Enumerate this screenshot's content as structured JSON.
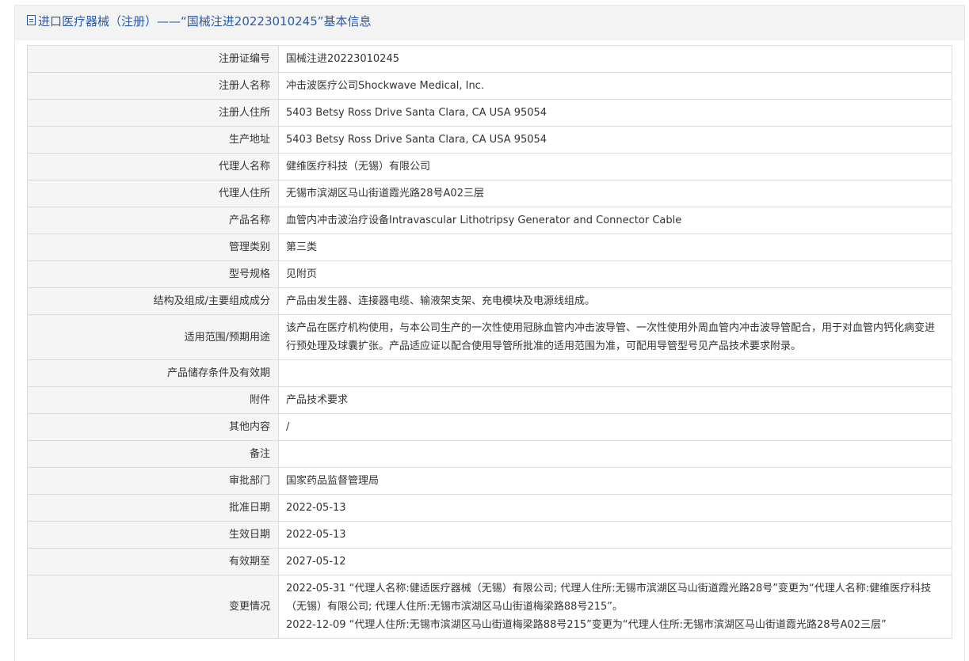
{
  "header": {
    "title": "进口医疗器械（注册）——“国械注进20223010245”基本信息"
  },
  "rows": [
    {
      "label": "注册证编号",
      "value": "国械注进20223010245"
    },
    {
      "label": "注册人名称",
      "value": "冲击波医疗公司Shockwave Medical, Inc."
    },
    {
      "label": "注册人住所",
      "value": "5403 Betsy Ross Drive Santa Clara, CA USA 95054"
    },
    {
      "label": "生产地址",
      "value": "5403 Betsy Ross Drive Santa Clara, CA USA 95054"
    },
    {
      "label": "代理人名称",
      "value": "健维医疗科技（无锡）有限公司"
    },
    {
      "label": "代理人住所",
      "value": "无锡市滨湖区马山街道霞光路28号A02三层"
    },
    {
      "label": "产品名称",
      "value": "血管内冲击波治疗设备Intravascular Lithotripsy Generator and Connector Cable"
    },
    {
      "label": "管理类别",
      "value": "第三类"
    },
    {
      "label": "型号规格",
      "value": "见附页"
    },
    {
      "label": "结构及组成/主要组成成分",
      "value": "产品由发生器、连接器电缆、输液架支架、充电模块及电源线组成。"
    },
    {
      "label": "适用范围/预期用途",
      "value": "该产品在医疗机构使用，与本公司生产的一次性使用冠脉血管内冲击波导管、一次性使用外周血管内冲击波导管配合，用于对血管内钙化病变进行预处理及球囊扩张。产品适应证以配合使用导管所批准的适用范围为准，可配用导管型号见产品技术要求附录。"
    },
    {
      "label": "产品储存条件及有效期",
      "value": ""
    },
    {
      "label": "附件",
      "value": "产品技术要求"
    },
    {
      "label": "其他内容",
      "value": "/"
    },
    {
      "label": "备注",
      "value": ""
    },
    {
      "label": "审批部门",
      "value": "国家药品监督管理局"
    },
    {
      "label": "批准日期",
      "value": "2022-05-13"
    },
    {
      "label": "生效日期",
      "value": "2022-05-13"
    },
    {
      "label": "有效期至",
      "value": "2027-05-12"
    }
  ],
  "changes": {
    "label": "变更情况",
    "entries": [
      "2022-05-31 “代理人名称:健适医疗器械（无锡）有限公司; 代理人住所:无锡市滨湖区马山街道霞光路28号”变更为“代理人名称:健维医疗科技（无锡）有限公司; 代理人住所:无锡市滨湖区马山街道梅梁路88号215”。",
      "2022-12-09 “代理人住所:无锡市滨湖区马山街道梅梁路88号215”变更为“代理人住所:无锡市滨湖区马山街道霞光路28号A02三层”"
    ]
  }
}
